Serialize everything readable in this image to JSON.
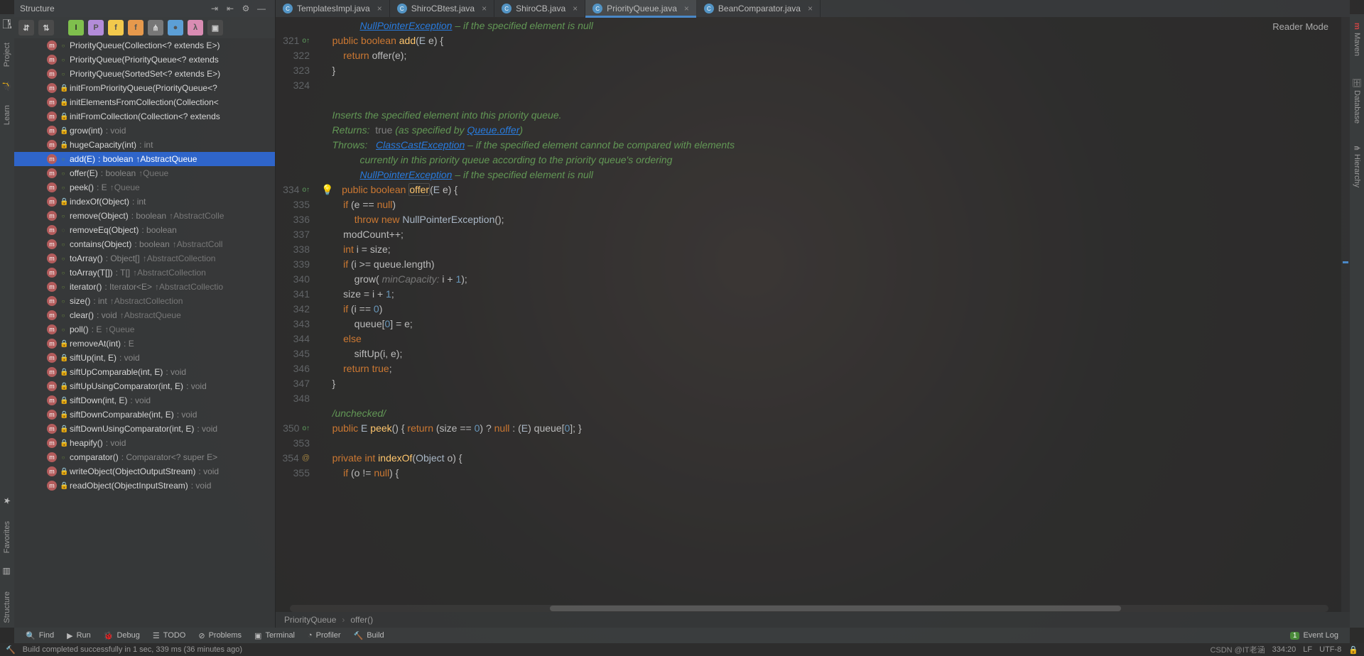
{
  "sidebar_left": {
    "tabs": [
      "Project",
      "Learn",
      "Favorites",
      "Structure"
    ]
  },
  "sidebar_right": {
    "tabs": [
      "Maven",
      "Database",
      "Hierarchy"
    ]
  },
  "structure": {
    "title": "Structure",
    "items": [
      {
        "vis": "pub",
        "sig": "PriorityQueue(Collection<? extends E>)",
        "type": "",
        "over": ""
      },
      {
        "vis": "pub",
        "sig": "PriorityQueue(PriorityQueue<? extends",
        "type": "",
        "over": ""
      },
      {
        "vis": "pub",
        "sig": "PriorityQueue(SortedSet<? extends E>)",
        "type": "",
        "over": ""
      },
      {
        "vis": "priv",
        "sig": "initFromPriorityQueue(PriorityQueue<?",
        "type": "",
        "over": ""
      },
      {
        "vis": "priv",
        "sig": "initElementsFromCollection(Collection<",
        "type": "",
        "over": ""
      },
      {
        "vis": "priv",
        "sig": "initFromCollection(Collection<? extends",
        "type": "",
        "over": ""
      },
      {
        "vis": "priv",
        "sig": "grow(int)",
        "type": ": void",
        "over": ""
      },
      {
        "vis": "priv",
        "sig": "hugeCapacity(int)",
        "type": ": int",
        "over": ""
      },
      {
        "vis": "pub",
        "sig": "add(E)",
        "type": ": boolean ",
        "over": "↑AbstractQueue",
        "selected": true
      },
      {
        "vis": "pub",
        "sig": "offer(E)",
        "type": ": boolean ",
        "over": "↑Queue"
      },
      {
        "vis": "pub",
        "sig": "peek()",
        "type": ": E ",
        "over": "↑Queue"
      },
      {
        "vis": "priv",
        "sig": "indexOf(Object)",
        "type": ": int",
        "over": ""
      },
      {
        "vis": "pub",
        "sig": "remove(Object)",
        "type": ": boolean ",
        "over": "↑AbstractColle"
      },
      {
        "vis": "pkg",
        "sig": "removeEq(Object)",
        "type": ": boolean",
        "over": ""
      },
      {
        "vis": "pub",
        "sig": "contains(Object)",
        "type": ": boolean ",
        "over": "↑AbstractColl"
      },
      {
        "vis": "pub",
        "sig": "toArray()",
        "type": ": Object[] ",
        "over": "↑AbstractCollection"
      },
      {
        "vis": "pub",
        "sig": "toArray(T[])",
        "type": ": T[] ",
        "over": "↑AbstractCollection"
      },
      {
        "vis": "pub",
        "sig": "iterator()",
        "type": ": Iterator<E> ",
        "over": "↑AbstractCollectio"
      },
      {
        "vis": "pub",
        "sig": "size()",
        "type": ": int ",
        "over": "↑AbstractCollection"
      },
      {
        "vis": "pub",
        "sig": "clear()",
        "type": ": void ",
        "over": "↑AbstractQueue"
      },
      {
        "vis": "pub",
        "sig": "poll()",
        "type": ": E ",
        "over": "↑Queue"
      },
      {
        "vis": "priv",
        "sig": "removeAt(int)",
        "type": ": E",
        "over": ""
      },
      {
        "vis": "priv",
        "sig": "siftUp(int, E)",
        "type": ": void",
        "over": ""
      },
      {
        "vis": "priv",
        "sig": "siftUpComparable(int, E)",
        "type": ": void",
        "over": ""
      },
      {
        "vis": "priv",
        "sig": "siftUpUsingComparator(int, E)",
        "type": ": void",
        "over": ""
      },
      {
        "vis": "priv",
        "sig": "siftDown(int, E)",
        "type": ": void",
        "over": ""
      },
      {
        "vis": "priv",
        "sig": "siftDownComparable(int, E)",
        "type": ": void",
        "over": ""
      },
      {
        "vis": "priv",
        "sig": "siftDownUsingComparator(int, E)",
        "type": ": void",
        "over": ""
      },
      {
        "vis": "priv",
        "sig": "heapify()",
        "type": ": void",
        "over": ""
      },
      {
        "vis": "pub",
        "sig": "comparator()",
        "type": ": Comparator<? super E>",
        "over": ""
      },
      {
        "vis": "priv",
        "sig": "writeObject(ObjectOutputStream)",
        "type": ": void",
        "over": ""
      },
      {
        "vis": "priv",
        "sig": "readObject(ObjectInputStream)",
        "type": ": void",
        "over": ""
      }
    ]
  },
  "tabs": [
    {
      "name": "TemplatesImpl.java",
      "active": false
    },
    {
      "name": "ShiroCBtest.java",
      "active": false
    },
    {
      "name": "ShiroCB.java",
      "active": false
    },
    {
      "name": "PriorityQueue.java",
      "active": true
    },
    {
      "name": "BeanComparator.java",
      "active": false
    }
  ],
  "reader_mode": "Reader Mode",
  "gutter_lines": [
    "",
    "321",
    "322",
    "323",
    "324",
    "",
    "",
    "",
    "",
    "",
    "",
    "334",
    "335",
    "336",
    "337",
    "338",
    "339",
    "340",
    "341",
    "342",
    "343",
    "344",
    "345",
    "346",
    "347",
    "348",
    "",
    "350",
    "353",
    "354",
    "355"
  ],
  "breadcrumbs": {
    "a": "PriorityQueue",
    "b": "offer()"
  },
  "tool_buttons": {
    "find": "Find",
    "run": "Run",
    "debug": "Debug",
    "todo": "TODO",
    "problems": "Problems",
    "terminal": "Terminal",
    "profiler": "Profiler",
    "build": "Build",
    "event_log": "Event Log",
    "badge": "1"
  },
  "status": {
    "msg": "Build completed successfully in 1 sec, 339 ms (36 minutes ago)",
    "pos": "334:20",
    "sep": "LF",
    "enc": "UTF-8",
    "watermark": "CSDN @IT老涵"
  },
  "code": {
    "doc_text": "    Inserts the specified element into this priority queue.",
    "doc_ret_lbl": "    Returns:  ",
    "doc_ret_code": "true",
    "doc_ret_tail": " (as specified by ",
    "doc_ret_link": "Queue.offer",
    "doc_ret_end": ")",
    "doc_thr_lbl": "    Throws:   ",
    "doc_thr_link": "ClassCastException",
    "doc_thr_tail": " – if the specified element cannot be compared with elements",
    "doc_thr_l2": "              currently in this priority queue according to the priority queue's ordering",
    "doc_thr_link2": "NullPointerException",
    "doc_thr_tail2": " – if the specified element is null",
    "hint_minCap": "minCapacity:"
  }
}
